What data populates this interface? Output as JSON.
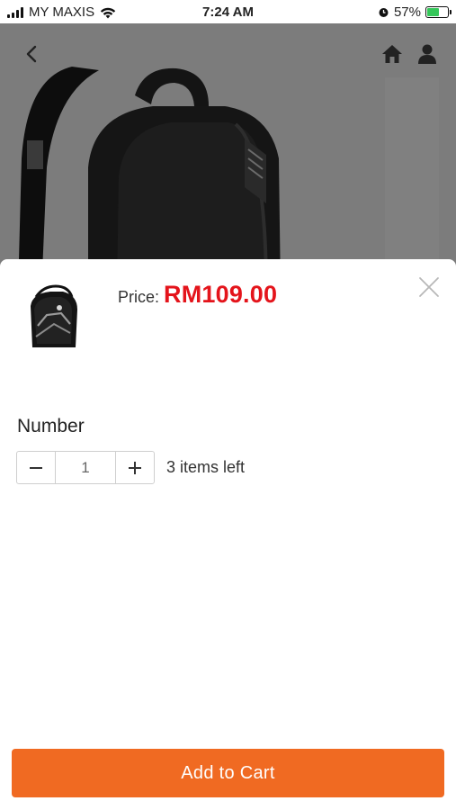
{
  "status_bar": {
    "carrier": "MY MAXIS",
    "time": "7:24 AM",
    "battery": "57%",
    "battery_level": 0.57,
    "icons": [
      "signal-icon",
      "wifi-icon",
      "alarm-icon",
      "battery-icon"
    ]
  },
  "nav": {
    "icons": [
      "back-icon",
      "home-icon",
      "user-icon"
    ]
  },
  "sheet": {
    "price_label": "Price:",
    "price_value": "RM109.00",
    "number_label": "Number",
    "quantity": "1",
    "stock_text": "3 items left",
    "add_to_cart": "Add to Cart",
    "icons": [
      "close-icon",
      "minus-icon",
      "plus-icon"
    ]
  },
  "colors": {
    "price": "#e4141b",
    "accent": "#f06a22",
    "overlay": "#7c7c7c"
  }
}
